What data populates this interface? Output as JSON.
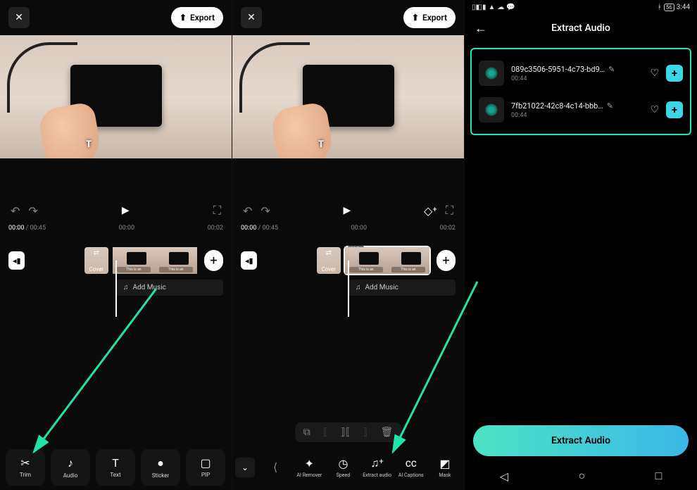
{
  "left": {
    "export_label": "Export",
    "time_now": "00:00",
    "time_total": "00:45",
    "tc1": "00:00",
    "tc2": "00:02",
    "cover_label": "Cover",
    "addmusic_label": "Add Music",
    "tools": {
      "trim": "Trim",
      "audio": "Audio",
      "text": "Text",
      "sticker": "Sticker",
      "pip": "PIP"
    }
  },
  "mid": {
    "export_label": "Export",
    "time_now": "00:00",
    "time_total": "00:45",
    "tc1": "00:00",
    "tc2": "00:02",
    "cover_label": "Cover",
    "clip_duration": "44.9s",
    "addmusic_label": "Add Music",
    "tools": {
      "airemover": "AI Remover",
      "speed": "Speed",
      "extractaudio": "Extract audio",
      "aicaptions": "AI Captions",
      "mask": "Mask"
    }
  },
  "right": {
    "status_time": "3:44",
    "status_battery": "56",
    "title": "Extract Audio",
    "items": [
      {
        "name": "089c3506-5951-4c73-bd9…",
        "duration": "00:44"
      },
      {
        "name": "7fb21022-42c8-4c14-bbb…",
        "duration": "00:44"
      }
    ],
    "extract_label": "Extract Audio"
  }
}
